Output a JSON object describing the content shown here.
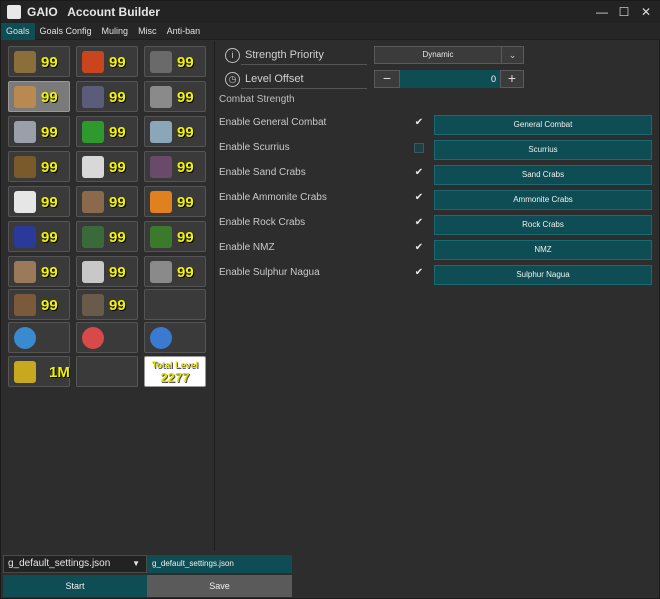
{
  "window": {
    "title": "GAIO   Account Builder",
    "minimize": "—",
    "maximize": "☐",
    "close": "✕"
  },
  "menu": {
    "tabs": [
      "Goals",
      "Goals Config",
      "Muling",
      "Misc",
      "Anti-ban"
    ]
  },
  "skills": {
    "tiles": [
      {
        "name": "attack",
        "level": "99",
        "color": "#8a6f3a"
      },
      {
        "name": "hitpoints",
        "level": "99",
        "color": "#c8451e"
      },
      {
        "name": "mining",
        "level": "99",
        "color": "#6a6a6a"
      },
      {
        "name": "strength",
        "level": "99",
        "color": "#b88a52"
      },
      {
        "name": "agility",
        "level": "99",
        "color": "#5b5b7a"
      },
      {
        "name": "smithing",
        "level": "99",
        "color": "#8a8a8a"
      },
      {
        "name": "defence",
        "level": "99",
        "color": "#9aa0aa"
      },
      {
        "name": "herblore",
        "level": "99",
        "color": "#2e9a2e"
      },
      {
        "name": "fishing",
        "level": "99",
        "color": "#8aa6b8"
      },
      {
        "name": "ranged",
        "level": "99",
        "color": "#7a5a2a"
      },
      {
        "name": "thieving",
        "level": "99",
        "color": "#d8d8d8"
      },
      {
        "name": "cooking",
        "level": "99",
        "color": "#6a4a6a"
      },
      {
        "name": "prayer",
        "level": "99",
        "color": "#e6e6e6"
      },
      {
        "name": "crafting",
        "level": "99",
        "color": "#8a6a4a"
      },
      {
        "name": "firemaking",
        "level": "99",
        "color": "#e0801e"
      },
      {
        "name": "magic",
        "level": "99",
        "color": "#2a3a9a"
      },
      {
        "name": "fletching",
        "level": "99",
        "color": "#3a6a3a"
      },
      {
        "name": "woodcutting",
        "level": "99",
        "color": "#3a7a2a"
      },
      {
        "name": "runecraft",
        "level": "99",
        "color": "#9a7a5a"
      },
      {
        "name": "slayer",
        "level": "99",
        "color": "#c8c8c8"
      },
      {
        "name": "farming",
        "level": "99",
        "color": "#8a8a8a"
      },
      {
        "name": "construction",
        "level": "99",
        "color": "#7a5a3a"
      },
      {
        "name": "hunter",
        "level": "99",
        "color": "#6a5a4a"
      },
      {
        "name": "sailing",
        "level": "",
        "color": "#4a4a4a"
      },
      {
        "name": "quest",
        "level": "",
        "color": "#3a8ad0"
      },
      {
        "name": "combat",
        "level": "",
        "color": "#d84a4a"
      },
      {
        "name": "diary",
        "level": "",
        "color": "#3a7ad0"
      },
      {
        "name": "gold",
        "level": "1M",
        "color": "#c8a81e"
      },
      {
        "name": "empty",
        "level": "",
        "color": "#3a3a3a"
      }
    ],
    "total_label": "Total Level",
    "total_value": "2277"
  },
  "combat": {
    "priority_label": "Strength Priority",
    "priority_value": "Dynamic",
    "offset_label": "Level Offset",
    "offset_value": "0",
    "minus": "−",
    "plus": "+",
    "section_label": "Combat Strength",
    "options": [
      {
        "label": "Enable General Combat",
        "checked": true,
        "button": "General Combat"
      },
      {
        "label": "Enable Scurrius",
        "checked": false,
        "button": "Scurrius"
      },
      {
        "label": "Enable Sand Crabs",
        "checked": true,
        "button": "Sand Crabs"
      },
      {
        "label": "Enable Ammonite Crabs",
        "checked": true,
        "button": "Ammonite Crabs"
      },
      {
        "label": "Enable Rock Crabs",
        "checked": true,
        "button": "Rock Crabs"
      },
      {
        "label": "Enable NMZ",
        "checked": true,
        "button": "NMZ"
      },
      {
        "label": "Enable Sulphur Nagua",
        "checked": true,
        "button": "Sulphur Nagua"
      }
    ]
  },
  "bottom": {
    "file_select": "g_default_settings.json",
    "file_name": "g_default_settings.json",
    "start": "Start",
    "save": "Save"
  },
  "colors": {
    "accent": "#0f4d55",
    "level": "#f2f200",
    "background": "#2d2d2d"
  }
}
